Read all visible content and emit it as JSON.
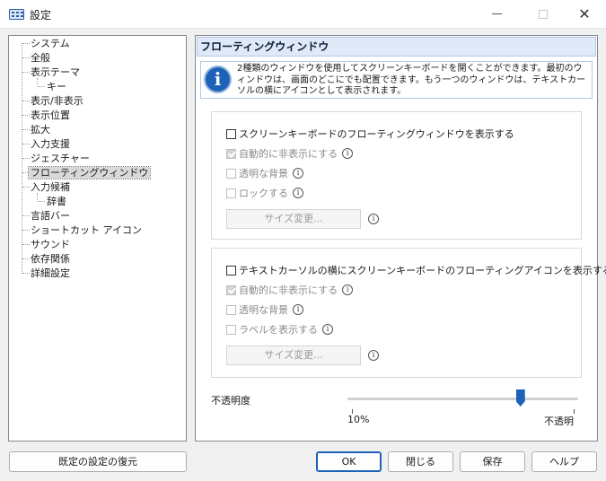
{
  "window": {
    "title": "設定"
  },
  "tree": {
    "items": [
      {
        "label": "システム"
      },
      {
        "label": "全般"
      },
      {
        "label": "表示テーマ"
      },
      {
        "label": "キー"
      },
      {
        "label": "表示/非表示"
      },
      {
        "label": "表示位置"
      },
      {
        "label": "拡大"
      },
      {
        "label": "入力支援"
      },
      {
        "label": "ジェスチャー"
      },
      {
        "label": "フローティングウィンドウ"
      },
      {
        "label": "入力候補"
      },
      {
        "label": "辞書"
      },
      {
        "label": "言語バー"
      },
      {
        "label": "ショートカット アイコン"
      },
      {
        "label": "サウンド"
      },
      {
        "label": "依存関係"
      },
      {
        "label": "詳細設定"
      }
    ],
    "selected": "フローティングウィンドウ"
  },
  "panel": {
    "title": "フローティングウィンドウ",
    "info_text": "2種類のウィンドウを使用してスクリーンキーボードを開くことができます。最初のウィンドウは、画面のどこにでも配置できます。もう一つのウィンドウは、テキストカーソルの横にアイコンとして表示されます。",
    "group1": {
      "main_label": "スクリーンキーボードのフローティングウィンドウを表示する",
      "auto_hide": "自動的に非表示にする",
      "transparent_bg": "透明な背景",
      "lock": "ロックする",
      "resize": "サイズ変更..."
    },
    "group2": {
      "main_label": "テキストカーソルの横にスクリーンキーボードのフローティングアイコンを表示する",
      "auto_hide": "自動的に非表示にする",
      "transparent_bg": "透明な背景",
      "show_label": "ラベルを表示する",
      "resize": "サイズ変更..."
    },
    "opacity": {
      "label": "不透明度",
      "min_label": "10%",
      "max_label": "不透明",
      "value_fraction": 0.76
    }
  },
  "buttons": {
    "restore": "既定の設定の復元",
    "ok": "OK",
    "close": "閉じる",
    "save": "保存",
    "help": "ヘルプ"
  },
  "icons": {
    "app": "keyboard-icon",
    "info": "info-icon",
    "help": "info-small-icon"
  },
  "colors": {
    "accent": "#1c62b8",
    "header_bg": "#dfe9f7"
  }
}
